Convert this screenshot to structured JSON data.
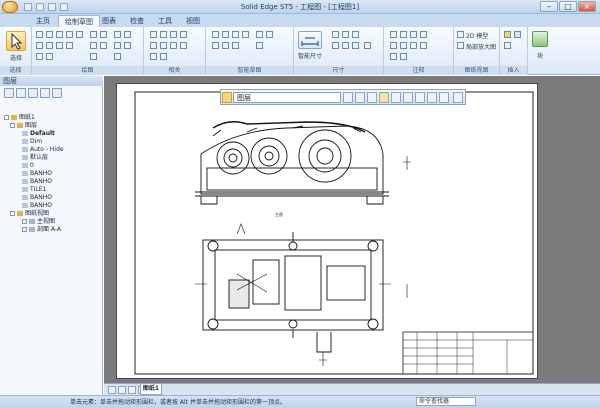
{
  "window": {
    "title": "Solid Edge ST5 - 工程图 - [工程图1]",
    "minimize_glyph": "–",
    "maximize_glyph": "□",
    "close_glyph": "×"
  },
  "tabs": [
    {
      "label": "主页"
    },
    {
      "label": "绘制草图"
    },
    {
      "label": "图表"
    },
    {
      "label": "检查"
    },
    {
      "label": "工具"
    },
    {
      "label": "视图"
    }
  ],
  "ribbon": {
    "select_label": "选择",
    "groups": [
      {
        "label": "选择"
      },
      {
        "label": "绘图"
      },
      {
        "label": "相关"
      },
      {
        "label": "智能草图"
      },
      {
        "label": "尺寸"
      },
      {
        "label": "注释"
      },
      {
        "label": "图纸视图"
      },
      {
        "label": "插入"
      }
    ],
    "smart_dimension_label": "智能尺寸",
    "view_2d_label": "2D 模型",
    "detail_view_label": "局部放大图",
    "block_label": "块"
  },
  "left_panel": {
    "title": "图层",
    "tree": [
      {
        "label": "图纸1"
      },
      {
        "label": "图层"
      },
      {
        "label": "Default"
      },
      {
        "label": "Dim"
      },
      {
        "label": "Auto - Hide"
      },
      {
        "label": "默认层"
      },
      {
        "label": "0"
      },
      {
        "label": "BANHO"
      },
      {
        "label": "BANHO"
      },
      {
        "label": "TILE1"
      },
      {
        "label": "BANHO"
      },
      {
        "label": "BANHO"
      },
      {
        "label": "图纸视图"
      },
      {
        "label": "主视图"
      },
      {
        "label": "剖面 A-A"
      }
    ]
  },
  "command_bar": {
    "layer_select_value": "图层"
  },
  "drawing": {
    "view_caption_top": "主视 - 视图",
    "title_block_note": "图纸1"
  },
  "sheet_tabs": {
    "active": "图纸1"
  },
  "status": {
    "prompt": "单击元素：单击并拖动矩形围栏，或者按 Alt 并单击并拖动矩形围栏的第一顶点。",
    "command_finder_placeholder": "命令查找器"
  },
  "colors": {
    "ribbon_bg": "#dde9f6",
    "canvas_bg": "#7b7b7b",
    "accent": "#f6c45c"
  }
}
